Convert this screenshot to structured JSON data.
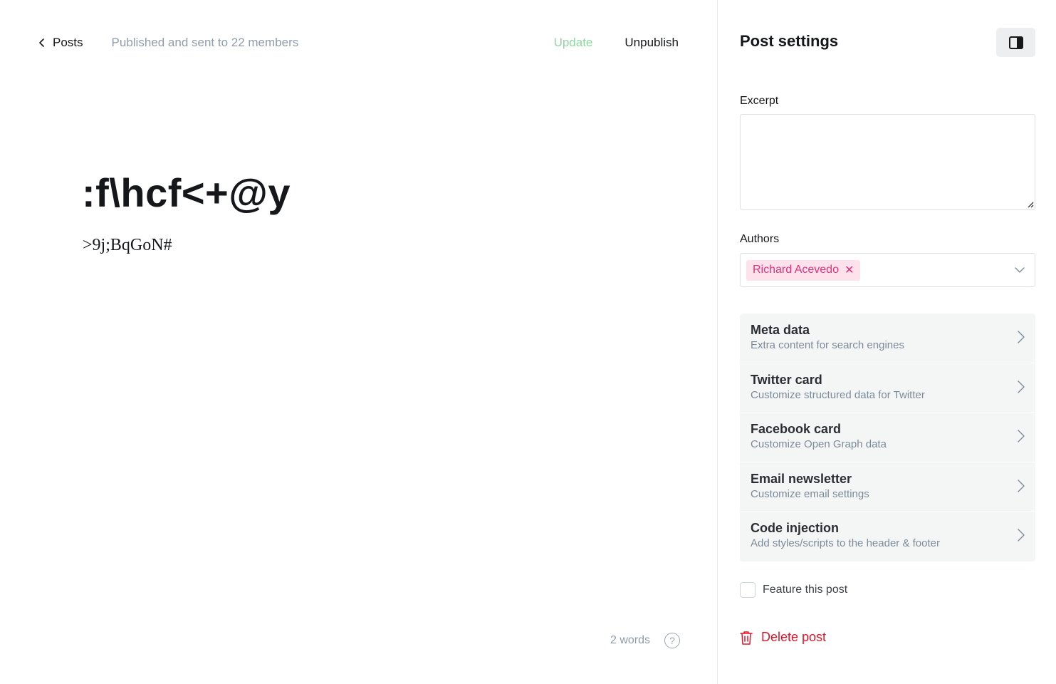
{
  "header": {
    "back_label": "Posts",
    "status": "Published and sent to 22 members",
    "update_label": "Update",
    "unpublish_label": "Unpublish"
  },
  "post": {
    "title": ":f\\hcf<+@y",
    "body": ">9j;BqGoN#"
  },
  "footer": {
    "word_count": "2 words",
    "help_glyph": "?"
  },
  "settings": {
    "title": "Post settings",
    "excerpt_label": "Excerpt",
    "excerpt_value": "",
    "authors_label": "Authors",
    "authors": [
      {
        "name": "Richard Acevedo",
        "remove_glyph": "✕"
      }
    ],
    "menu": [
      {
        "title": "Meta data",
        "subtitle": "Extra content for search engines"
      },
      {
        "title": "Twitter card",
        "subtitle": "Customize structured data for Twitter"
      },
      {
        "title": "Facebook card",
        "subtitle": "Customize Open Graph data"
      },
      {
        "title": "Email newsletter",
        "subtitle": "Customize email settings"
      },
      {
        "title": "Code injection",
        "subtitle": "Add styles/scripts to the header & footer"
      }
    ],
    "feature_label": "Feature this post",
    "feature_checked": false,
    "delete_label": "Delete post"
  },
  "colors": {
    "update_green": "#8dd6a0",
    "author_chip_bg": "#fde2ec",
    "author_chip_text": "#e5307a",
    "delete_red": "#e1142b",
    "menu_bg": "#f4f5f5"
  },
  "icons": [
    "chevron-left-icon",
    "help-circle-icon",
    "sidebar-toggle-icon",
    "chevron-down-icon",
    "chevron-right-icon",
    "trash-icon",
    "close-icon"
  ]
}
